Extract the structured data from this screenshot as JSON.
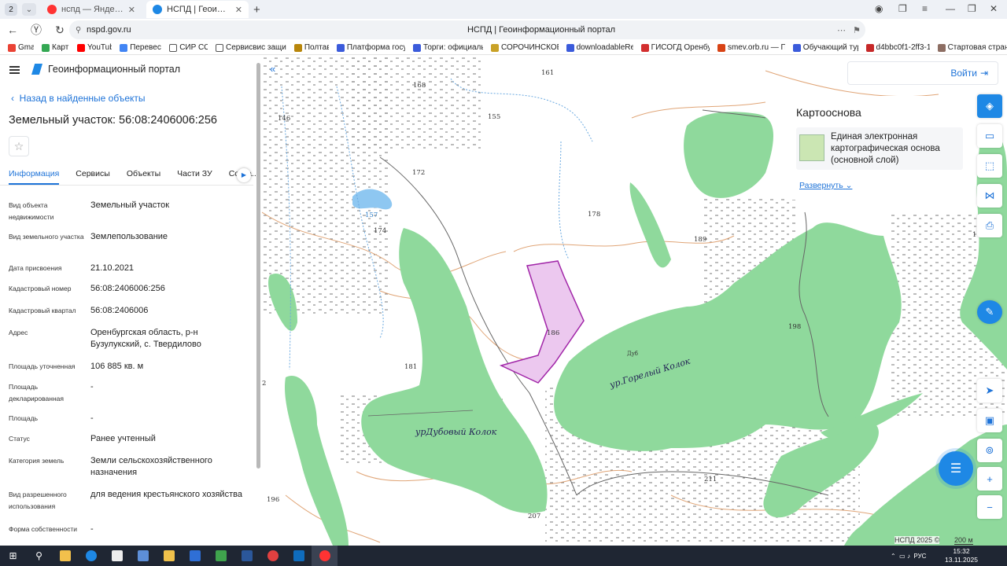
{
  "browser": {
    "tab_count": "2",
    "tabs": [
      {
        "title": "нспд — Яндекс: нашлось",
        "active": false,
        "favicon_color": "#ff3333"
      },
      {
        "title": "НСПД | Геоинформацио",
        "active": true,
        "favicon_color": "#1e88e5"
      }
    ],
    "url": "nspd.gov.ru",
    "page_title": "НСПД | Геоинформационный портал",
    "bookmarks": [
      {
        "label": "Gmail",
        "color": "#ea4335"
      },
      {
        "label": "Карты",
        "color": "#34a853"
      },
      {
        "label": "YouTube",
        "color": "#ff0000"
      },
      {
        "label": "Перевести",
        "color": "#4285f4"
      },
      {
        "label": "СИР СОУ",
        "color": "#555555"
      },
      {
        "label": "Сервисвис защищ...",
        "color": "#555555"
      },
      {
        "label": "Полтава",
        "color": "#b8860b"
      },
      {
        "label": "Платформа госуд...",
        "color": "#3b5bdb"
      },
      {
        "label": "Торги: официальн...",
        "color": "#3b5bdb"
      },
      {
        "label": "СОРОЧИНСКОЕ ...",
        "color": "#c9a227"
      },
      {
        "label": "downloadableRes...",
        "color": "#3b5bdb"
      },
      {
        "label": "ГИСОГД Оренбур...",
        "color": "#d32f2f"
      },
      {
        "label": "smev.orb.ru — По...",
        "color": "#d84315"
      },
      {
        "label": "Обучающий тур ...",
        "color": "#3b5bdb"
      },
      {
        "label": "d4bbc0f1-2ff3-11...",
        "color": "#c62828"
      },
      {
        "label": "Стартовая страни...",
        "color": "#8d6e63"
      }
    ]
  },
  "panel": {
    "app_title": "Геоинформационный портал",
    "back_link": "Назад в найденные объекты",
    "title": "Земельный участок: 56:08:2406006:256",
    "tabs": [
      "Информация",
      "Сервисы",
      "Объекты",
      "Части ЗУ",
      "Соста..."
    ],
    "properties": [
      {
        "key": "Вид объекта недвижимости",
        "value": "Земельный участок"
      },
      {
        "key": "Вид земельного участка",
        "value": "Землепользование"
      },
      {
        "key": "Дата присвоения",
        "value": "21.10.2021"
      },
      {
        "key": "Кадастровый номер",
        "value": "56:08:2406006:256"
      },
      {
        "key": "Кадастровый квартал",
        "value": "56:08:2406006"
      },
      {
        "key": "Адрес",
        "value": "Оренбургская область, р-н Бузулукский, с. Твердилово"
      },
      {
        "key": "Площадь уточненная",
        "value": "106 885 кв. м"
      },
      {
        "key": "Площадь декларированная",
        "value": "-"
      },
      {
        "key": "Площадь",
        "value": "-"
      },
      {
        "key": "Статус",
        "value": "Ранее учтенный"
      },
      {
        "key": "Категория земель",
        "value": "Земли сельскохозяйственного назначения"
      },
      {
        "key": "Вид разрешенного использования",
        "value": "для ведения крестьянского хозяйства"
      },
      {
        "key": "Форма собственности",
        "value": "-"
      }
    ]
  },
  "map": {
    "login_label": "Войти",
    "basemap_title": "Картооснова",
    "basemap_item": "Единая электронная картографическая основа (основной слой)",
    "expand_label": "Развернуть",
    "place_labels": [
      "ур.Горелый Колок",
      "урДубовый Колок",
      "Дуб"
    ],
    "elevation_labels": [
      "168",
      "161",
      "146",
      "155",
      "172",
      "157",
      "174",
      "178",
      "189",
      "176",
      "186",
      "181",
      "198",
      "196",
      "211",
      "207",
      "2"
    ],
    "attribution": "НСПД 2025 ©",
    "scale": "200 м",
    "colors": {
      "forest": "#8fd99c",
      "parcel_fill": "#ecc8ef",
      "parcel_stroke": "#a126a8",
      "accent": "#1e88e5"
    }
  },
  "taskbar": {
    "language": "РУС",
    "time": "15:32",
    "date": "13.11.2025"
  }
}
